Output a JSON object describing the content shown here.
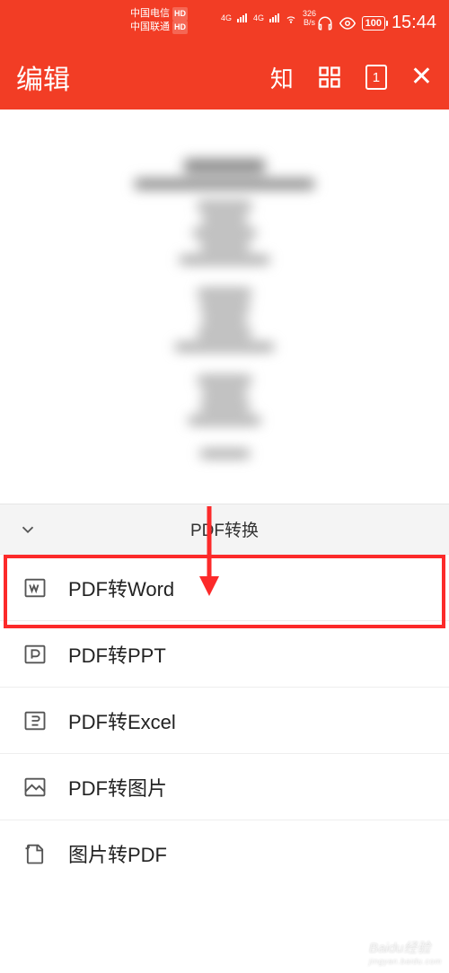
{
  "status_bar": {
    "carrier1": "中国电信",
    "carrier2": "中国联通",
    "hd": "HD",
    "network_label": "4G",
    "speed_value": "326",
    "speed_unit": "B/s",
    "battery": "100",
    "time": "15:44"
  },
  "header": {
    "title": "编辑",
    "zhi": "知",
    "page_num": "1"
  },
  "sheet": {
    "title": "PDF转换",
    "items": [
      {
        "label": "PDF转Word",
        "icon": "word-icon"
      },
      {
        "label": "PDF转PPT",
        "icon": "ppt-icon"
      },
      {
        "label": "PDF转Excel",
        "icon": "excel-icon"
      },
      {
        "label": "PDF转图片",
        "icon": "image-icon"
      },
      {
        "label": "图片转PDF",
        "icon": "img-to-pdf-icon"
      }
    ]
  },
  "watermark": {
    "line1": "Baidu经验",
    "line2": "jingyan.baidu.com"
  }
}
